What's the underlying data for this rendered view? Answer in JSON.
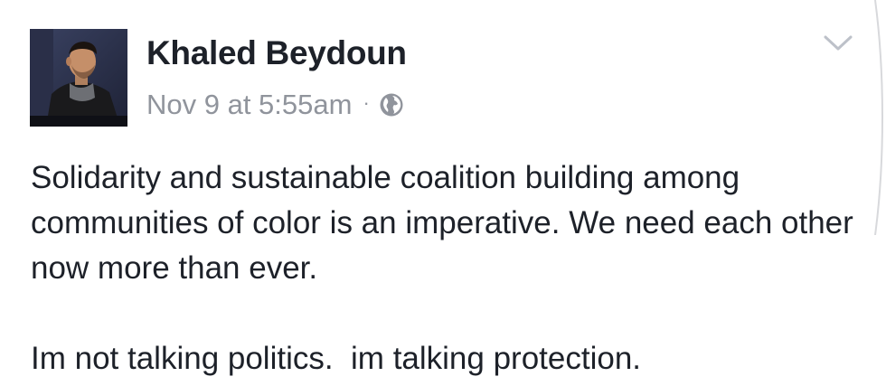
{
  "post": {
    "author": {
      "name": "Khaled Beydoun",
      "avatar_icon": "profile-photo"
    },
    "timestamp": "Nov 9 at 5:55am",
    "separator": "·",
    "privacy_icon": "globe-icon",
    "menu_icon": "chevron-down-icon",
    "body": {
      "paragraph_1": "Solidarity and sustainable coalition building among communities of color is an imperative. We need each other now more than ever.",
      "paragraph_2": "Im not talking politics.  im talking protection."
    }
  },
  "colors": {
    "text": "#1d2129",
    "secondary": "#90949c",
    "background": "#ffffff"
  }
}
